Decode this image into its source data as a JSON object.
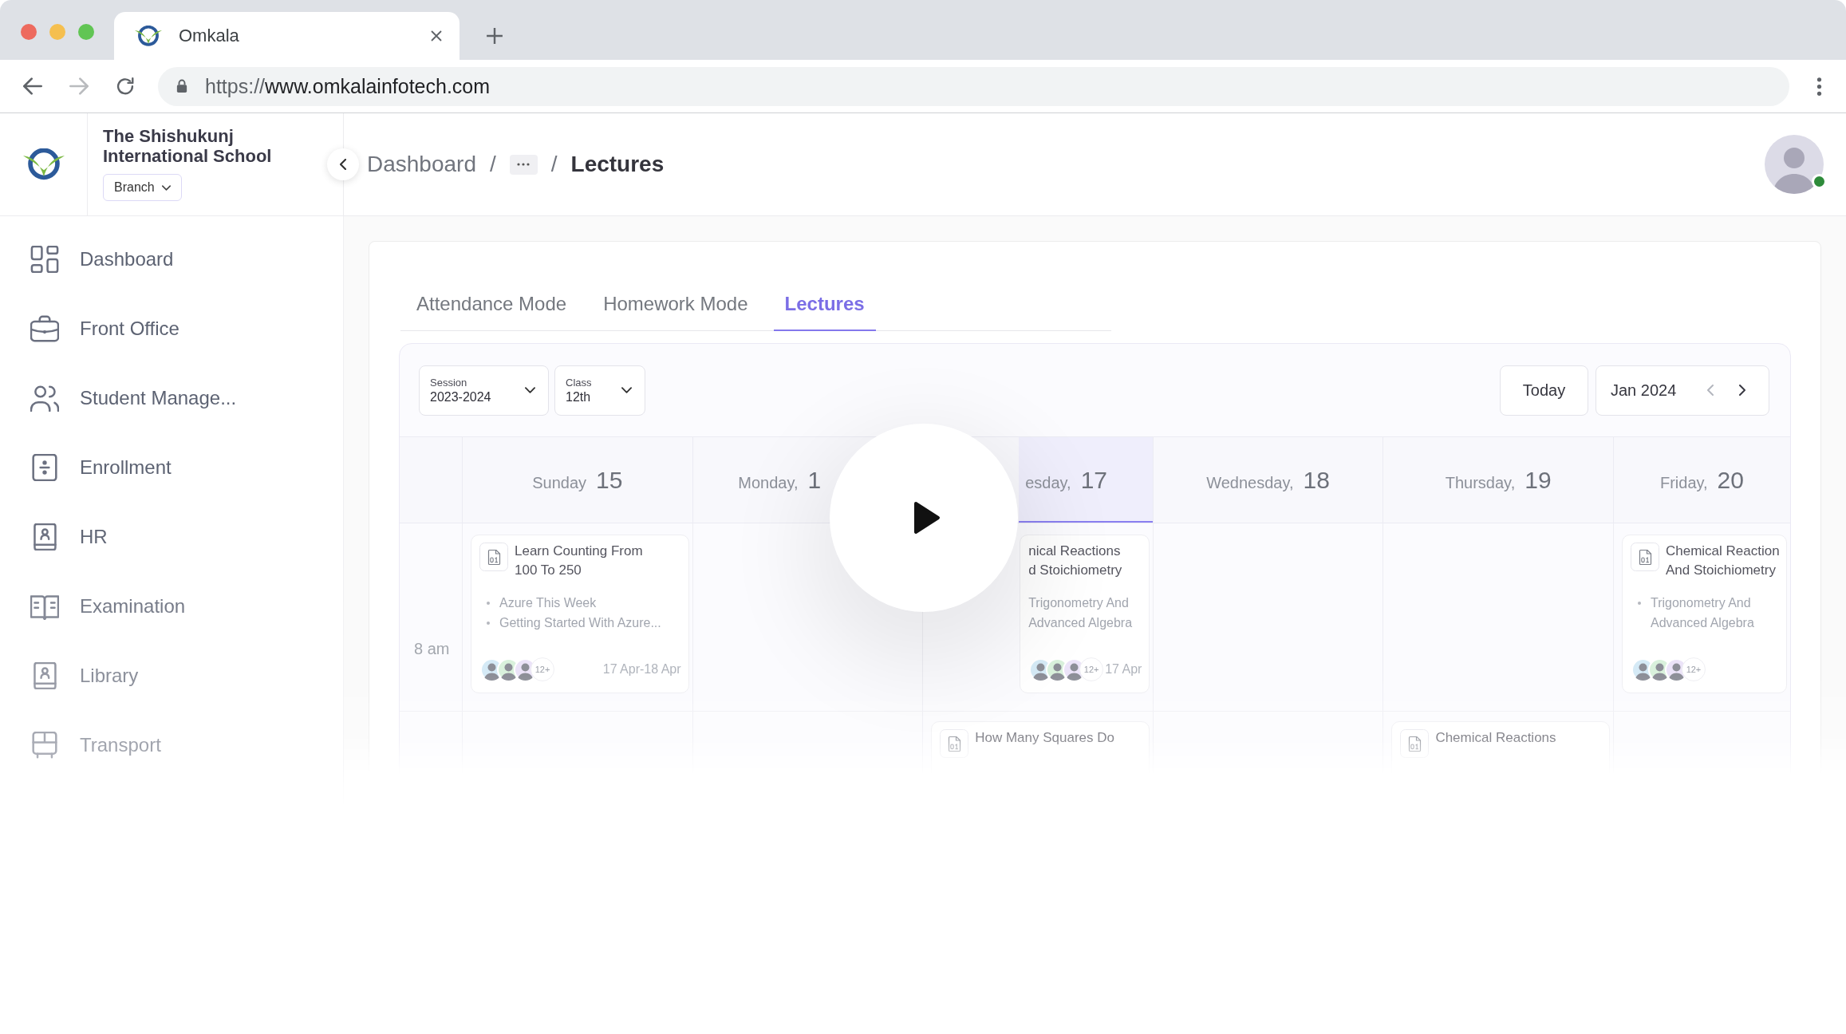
{
  "browser": {
    "tab_title": "Omkala",
    "nav": [
      {
        "kind": "back",
        "disabled": false
      },
      {
        "kind": "forward",
        "disabled": true
      },
      {
        "kind": "reload",
        "disabled": false
      }
    ],
    "url_scheme": "https://",
    "url_host": "www.omkalainfotech.com"
  },
  "school": {
    "name": "The Shishukunj International School",
    "branch": "Branch"
  },
  "breadcrumb": [
    {
      "kind": "link",
      "label": "Dashboard"
    },
    {
      "kind": "separator",
      "label": "/"
    },
    {
      "kind": "more"
    },
    {
      "kind": "separator",
      "label": "/"
    },
    {
      "kind": "current",
      "label": "Lectures"
    }
  ],
  "user": {
    "online": true
  },
  "sidebar": {
    "items": [
      {
        "kind": "grid",
        "label": "Dashboard"
      },
      {
        "kind": "briefcase",
        "label": "Front Office"
      },
      {
        "kind": "users",
        "label": "Student Manage..."
      },
      {
        "kind": "divide",
        "label": "Enrollment"
      },
      {
        "kind": "contact",
        "label": "HR"
      },
      {
        "kind": "book",
        "label": "Examination"
      },
      {
        "kind": "contact",
        "label": "Library"
      },
      {
        "kind": "bus",
        "label": "Transport"
      }
    ]
  },
  "tabs": [
    {
      "label": "Attendance Mode",
      "selected": false
    },
    {
      "label": "Homework Mode",
      "selected": false
    },
    {
      "label": "Lectures",
      "selected": true
    }
  ],
  "filters": [
    {
      "label": "Session",
      "value": "2023-2024"
    },
    {
      "label": "Class",
      "value": "12th"
    }
  ],
  "today": "Today",
  "month": {
    "label": "Jan 2024",
    "nav": [
      {
        "kind": "prev",
        "disabled": true
      },
      {
        "kind": "next",
        "disabled": false
      }
    ]
  },
  "days": [
    {
      "name": "Sunday",
      "date": "15",
      "selected": false
    },
    {
      "name": "Monday,",
      "date": "1",
      "selected": false
    },
    {
      "name": "esday,",
      "date": "17",
      "selected": true
    },
    {
      "name": "Wednesday,",
      "date": "18",
      "selected": false
    },
    {
      "name": "Thursday,",
      "date": "19",
      "selected": false
    },
    {
      "name": "Friday,",
      "date": "20",
      "selected": false
    }
  ],
  "rows": [
    {
      "label": "8 am",
      "cells": [
        {
          "events": [
            {
              "icon": true,
              "title_lines": [
                "Learn Counting From",
                "100 To 250"
              ],
              "items": [
                {
                  "text": "Azure This Week",
                  "bullet": true
                },
                {
                  "text": "Getting Started With Azure...",
                  "bullet": true
                }
              ],
              "more": "12+",
              "date": "17 Apr-18 Apr"
            }
          ]
        },
        {},
        {
          "events": [
            {
              "icon": false,
              "title_lines": [
                "nical Reactions",
                "d Stoichiometry"
              ],
              "items": [
                {
                  "text": "Trigonometry And Advanced Algebra",
                  "bullet": false
                }
              ],
              "more": "12+",
              "date": "17 Apr"
            }
          ]
        },
        {},
        {},
        {
          "events": [
            {
              "icon": true,
              "title_lines": [
                "Chemical Reaction",
                "And Stoichiometry"
              ],
              "items": [
                {
                  "text": "Trigonometry And Advanced Algebra",
                  "bullet": true
                }
              ],
              "more": "12+"
            }
          ]
        }
      ]
    },
    {
      "cells": [
        {},
        {},
        {
          "events": [
            {
              "icon": true,
              "title_lines": [
                "How Many Squares Do"
              ]
            }
          ]
        },
        {},
        {
          "events": [
            {
              "icon": true,
              "title_lines": [
                "Chemical Reactions"
              ]
            }
          ]
        },
        {}
      ]
    }
  ]
}
